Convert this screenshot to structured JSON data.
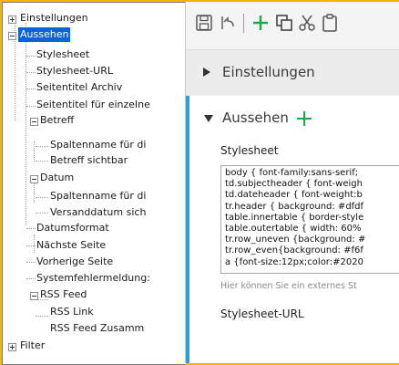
{
  "tree": {
    "einstellungen": "Einstellungen",
    "aussehen": "Aussehen",
    "stylesheet": "Stylesheet",
    "stylesheet_url": "Stylesheet-URL",
    "seitentitel_archiv": "Seitentitel Archiv",
    "seitentitel_einzelne": "Seitentitel für einzelne",
    "betreff": "Betreff",
    "spaltenname_betreff": "Spaltenname für di",
    "betreff_sichtbar": "Betreff sichtbar",
    "datum": "Datum",
    "spaltenname_datum": "Spaltenname für di",
    "versanddatum": "Versanddatum sich",
    "datumsformat": "Datumsformat",
    "naechste_seite": "Nächste Seite",
    "vorherige_seite": "Vorherige Seite",
    "systemfehler": "Systemfehlermeldung:",
    "rss_feed": "RSS Feed",
    "rss_link": "RSS Link",
    "rss_feed_zusammen": "RSS Feed Zusamm",
    "filter": "Filter"
  },
  "sections": {
    "einstellungen": "Einstellungen",
    "aussehen": "Aussehen"
  },
  "fields": {
    "stylesheet_label": "Stylesheet",
    "stylesheet_value": "body { font-family:sans-serif;\ntd.subjectheader { font-weigh\ntd.dateheader { font-weight:b\ntr.header { background: #dfdf\ntable.innertable { border-style\ntable.outertable { width: 60%\ntr.row_uneven {background: #\ntr.row_even{background: #f6f\na {font-size:12px;color:#2020",
    "stylesheet_hint": "Hier können Sie ein externes St",
    "stylesheet_url_label": "Stylesheet-URL"
  },
  "icons": {
    "save": "save-icon",
    "undo": "undo-icon",
    "add": "plus-icon",
    "copy": "copy-icon",
    "cut": "scissors-icon",
    "paste": "clipboard-icon"
  },
  "colors": {
    "background": "#f2b800",
    "selection": "#0a64d8",
    "accent_green": "#1aa84a",
    "section_accent": "#2aa0d8"
  }
}
